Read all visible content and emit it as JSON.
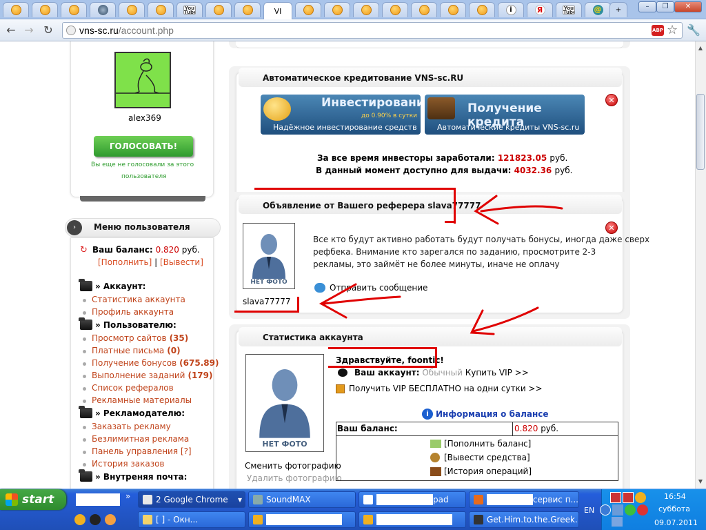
{
  "browser": {
    "tabs": [
      {
        "icon": "orange"
      },
      {
        "icon": "orange"
      },
      {
        "icon": "orange"
      },
      {
        "icon": "globe"
      },
      {
        "icon": "orange"
      },
      {
        "icon": "orange"
      },
      {
        "icon": "yt",
        "label": "You Tube"
      },
      {
        "icon": "orange"
      },
      {
        "icon": "orange"
      },
      {
        "icon": "active",
        "label": "VI"
      },
      {
        "icon": "orange"
      },
      {
        "icon": "orange"
      },
      {
        "icon": "orange"
      },
      {
        "icon": "orange"
      },
      {
        "icon": "orange"
      },
      {
        "icon": "orange"
      },
      {
        "icon": "orange"
      },
      {
        "icon": "info",
        "label": "i"
      },
      {
        "icon": "ya",
        "label": "Я"
      },
      {
        "icon": "yt",
        "label": "You Tube"
      },
      {
        "icon": "mail",
        "label": "@"
      }
    ],
    "new_tab": "+",
    "url_host": "vns-sc.ru",
    "url_path": "/account.php",
    "abp_label": "ABP",
    "star": "☆",
    "wrench": "🔧",
    "window_controls": [
      "–",
      "❐",
      "✕"
    ]
  },
  "sidebar": {
    "username": "alex369",
    "vote_button": "ГОЛОСОВАТЬ!",
    "vote_note_1": "Вы еще не голосовали за этого",
    "vote_note_2": "пользователя",
    "menu_title": "Меню пользователя",
    "balance_label": "Ваш баланс:",
    "balance_value": "0.820",
    "balance_currency": "руб.",
    "topup_link": "[Пополнить]",
    "sep": "|",
    "withdraw_link": "[Вывести]",
    "sections": [
      {
        "title": "» Аккаунт:",
        "items": [
          {
            "label": "Статистика аккаунта"
          },
          {
            "label": "Профиль аккаунта"
          }
        ]
      },
      {
        "title": "» Пользователю:",
        "items": [
          {
            "label": "Просмотр сайтов",
            "count": "(35)"
          },
          {
            "label": "Платные письма",
            "count": "(0)"
          },
          {
            "label": "Получение бонусов",
            "count": "(675.89)"
          },
          {
            "label": "Выполнение заданий",
            "count": "(179)"
          },
          {
            "label": "Список рефералов"
          },
          {
            "label": "Рекламные материалы"
          }
        ]
      },
      {
        "title": "» Рекламодателю:",
        "items": [
          {
            "label": "Заказать рекламу"
          },
          {
            "label": "Безлимитная реклама"
          },
          {
            "label": "Панель управления [?]"
          },
          {
            "label": "История заказов"
          }
        ]
      },
      {
        "title": "» Внутреняя почта:",
        "items": []
      }
    ]
  },
  "credit": {
    "title": "Автоматическое кредитование VNS-sc.RU",
    "banner1_title": "Инвестирование",
    "banner1_sub": "до 0.90% в сутки",
    "banner1_tag": "Надёжное инвестирование средств",
    "banner2_title": "Получение кредита",
    "banner2_tag": "Автоматические кредиты VNS-sc.ru",
    "earned_label": "За все время инвесторы заработали:",
    "earned_value": "121823.05",
    "earned_unit": "руб.",
    "available_label": "В данный момент доступно для выдачи:",
    "available_value": "4032.36",
    "available_unit": "руб."
  },
  "referrer": {
    "title": "Объявление от Вашего реферера slava77777",
    "avatar_caption": "НЕТ ФОТО",
    "username": "slava77777",
    "message_lines": [
      "Все кто будут активно работать будут получать бонусы, иногда даже сверх",
      "рефбека. Внимание кто зарегался по заданию, просмотрите 2-3",
      "рекламы, это займёт не более минуты, иначе не оплачу"
    ],
    "send_message": "Отправить сообщение"
  },
  "stats": {
    "title": "Статистика аккаунта",
    "avatar_caption": "НЕТ ФОТО",
    "greeting": "Здравствуйте, foontic!",
    "account_label": "Ваш аккаунт:",
    "account_type": "Обычный",
    "buy_vip": "Купить VIP >>",
    "free_vip": "Получить VIP БЕСПЛАТНО на одни сутки >>",
    "change_photo": "Сменить фотографию",
    "delete_photo": "Удалить фотографию",
    "balance_info_title": "Информация о балансе",
    "balance_label": "Ваш баланс:",
    "balance_value": "0.820",
    "balance_unit": "руб.",
    "actions": [
      "[Пополнить баланс]",
      "[Вывести средства]",
      "[История операций]"
    ]
  },
  "taskbar": {
    "start": "start",
    "chevron": "»",
    "row1": [
      {
        "label": "2 Google Chrome",
        "icon": "chrome",
        "active": true
      },
      {
        "label": "SoundMAX",
        "icon": "sound"
      },
      {
        "label": "pad",
        "icon": "note",
        "redacted": true
      },
      {
        "label": "сервис п...",
        "icon": "ff",
        "redacted": true
      }
    ],
    "row2": [
      {
        "label": "[           ] - Окн...",
        "icon": "folder"
      },
      {
        "label": "",
        "icon": "msg",
        "redacted": true
      },
      {
        "label": "",
        "icon": "skype",
        "redacted": true
      },
      {
        "label": "Get.Him.to.the.Greek...",
        "icon": "film"
      }
    ],
    "lang": "EN",
    "time": "16:54",
    "day": "суббота",
    "date": "09.07.2011"
  },
  "colors": {
    "accent_red": "#cc0000",
    "link_orange": "#c0431a",
    "vote_green": "#3fa33f",
    "annotation_red": "#e00000"
  }
}
